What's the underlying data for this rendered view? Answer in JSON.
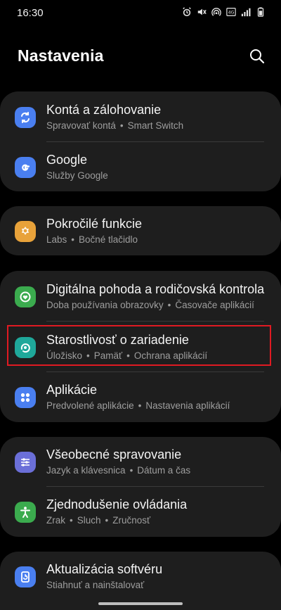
{
  "status_bar": {
    "time": "16:30",
    "icons": [
      "alarm-icon",
      "mute-icon",
      "hotspot-icon",
      "volte-icon",
      "signal-icon",
      "battery-icon"
    ]
  },
  "header": {
    "title": "Nastavenia",
    "search_icon": "search-icon"
  },
  "cards": [
    {
      "items": [
        {
          "title": "Kontá a zálohovanie",
          "subtitle": [
            "Spravovať kontá",
            "Smart Switch"
          ],
          "icon": "sync-icon",
          "color": "#4a7ff0"
        },
        {
          "title": "Google",
          "subtitle": [
            "Služby Google"
          ],
          "icon": "google-icon",
          "color": "#4a7ff0"
        }
      ]
    },
    {
      "items": [
        {
          "title": "Pokročilé funkcie",
          "subtitle": [
            "Labs",
            "Bočné tlačidlo"
          ],
          "icon": "advanced-features-icon",
          "color": "#e8a23a"
        }
      ]
    },
    {
      "items": [
        {
          "title": "Digitálna pohoda a rodičovská kontrola",
          "subtitle": [
            "Doba používania obrazovky",
            "Časovače aplikácií"
          ],
          "icon": "digital-wellbeing-icon",
          "color": "#3bab4e"
        },
        {
          "title": "Starostlivosť o zariadenie",
          "subtitle": [
            "Úložisko",
            "Pamäť",
            "Ochrana aplikácií"
          ],
          "icon": "device-care-icon",
          "color": "#1fa89a"
        },
        {
          "title": "Aplikácie",
          "subtitle": [
            "Predvolené aplikácie",
            "Nastavenia aplikácií"
          ],
          "icon": "apps-icon",
          "color": "#4a7ff0"
        }
      ]
    },
    {
      "items": [
        {
          "title": "Všeobecné spravovanie",
          "subtitle": [
            "Jazyk a klávesnica",
            "Dátum a čas"
          ],
          "icon": "general-management-icon",
          "color": "#6b6fd8"
        },
        {
          "title": "Zjednodušenie ovládania",
          "subtitle": [
            "Zrak",
            "Sluch",
            "Zručnosť"
          ],
          "icon": "accessibility-icon",
          "color": "#3bab4e"
        }
      ]
    },
    {
      "items": [
        {
          "title": "Aktualizácia softvéru",
          "subtitle": [
            "Stiahnuť a nainštalovať"
          ],
          "icon": "software-update-icon",
          "color": "#4a7ff0"
        }
      ]
    }
  ],
  "colors": {
    "background": "#000000",
    "card": "#1e1e1e",
    "highlight_border": "#e01a22",
    "subtitle": "#9e9e9e"
  }
}
